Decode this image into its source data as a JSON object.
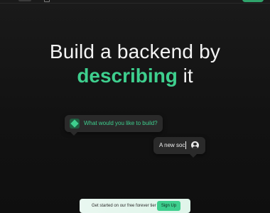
{
  "hero": {
    "line1": "Build a backend by",
    "accent_word": "describing",
    "line2_rest": " it"
  },
  "chat": {
    "ai_prompt": "What would you like to build?",
    "user_input": "A new soc"
  },
  "banner": {
    "text": "Get started on our free forever tier",
    "button_label": "Sign Up"
  },
  "icons": {
    "ai": "diamond-logo-icon",
    "user": "user-avatar-icon"
  },
  "colors": {
    "accent": "#3ecf8e",
    "background": "#141414",
    "bubble": "#2a2a2a",
    "banner_bg": "#e9f7f0"
  }
}
